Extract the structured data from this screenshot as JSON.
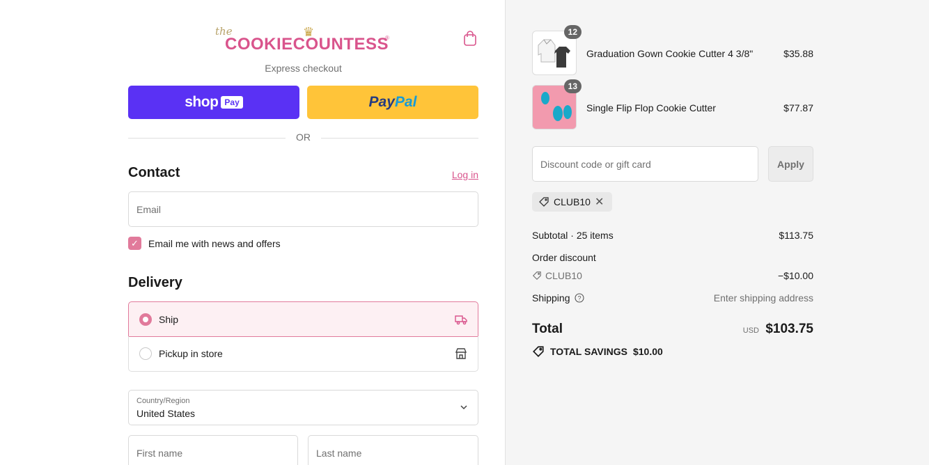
{
  "brand": {
    "the": "the",
    "name": "COOKIECOUNTESS",
    "registered": "®"
  },
  "express": {
    "label": "Express checkout",
    "shop_word": "shop",
    "shop_pay_box": "Pay",
    "paypal_a": "Pay",
    "paypal_b": "Pal"
  },
  "divider": "OR",
  "contact": {
    "heading": "Contact",
    "login": "Log in",
    "email_placeholder": "Email",
    "newsletter_label": "Email me with news and offers",
    "newsletter_checked": true
  },
  "delivery": {
    "heading": "Delivery",
    "options": [
      {
        "label": "Ship",
        "selected": true,
        "icon": "truck-icon"
      },
      {
        "label": "Pickup in store",
        "selected": false,
        "icon": "store-icon"
      }
    ],
    "country_label": "Country/Region",
    "country_value": "United States",
    "first_name": "First name",
    "last_name": "Last name"
  },
  "cart": {
    "items": [
      {
        "name": "Graduation Gown Cookie Cutter 4 3/8\"",
        "price": "$35.88",
        "qty": "12"
      },
      {
        "name": "Single Flip Flop Cookie Cutter",
        "price": "$77.87",
        "qty": "13"
      }
    ],
    "discount_placeholder": "Discount code or gift card",
    "apply_label": "Apply",
    "applied_code": "CLUB10",
    "subtotal_label": "Subtotal · 25 items",
    "subtotal_value": "$113.75",
    "order_discount_label": "Order discount",
    "discount_code": "CLUB10",
    "discount_value": "−$10.00",
    "shipping_label": "Shipping",
    "shipping_value": "Enter shipping address",
    "total_label": "Total",
    "currency": "USD",
    "total_value": "$103.75",
    "savings_label": "TOTAL SAVINGS",
    "savings_value": "$10.00"
  },
  "colors": {
    "accent": "#e17a9b",
    "shop_pay": "#5a31f4",
    "paypal": "#ffc439",
    "brand_pink": "#d9548c"
  }
}
